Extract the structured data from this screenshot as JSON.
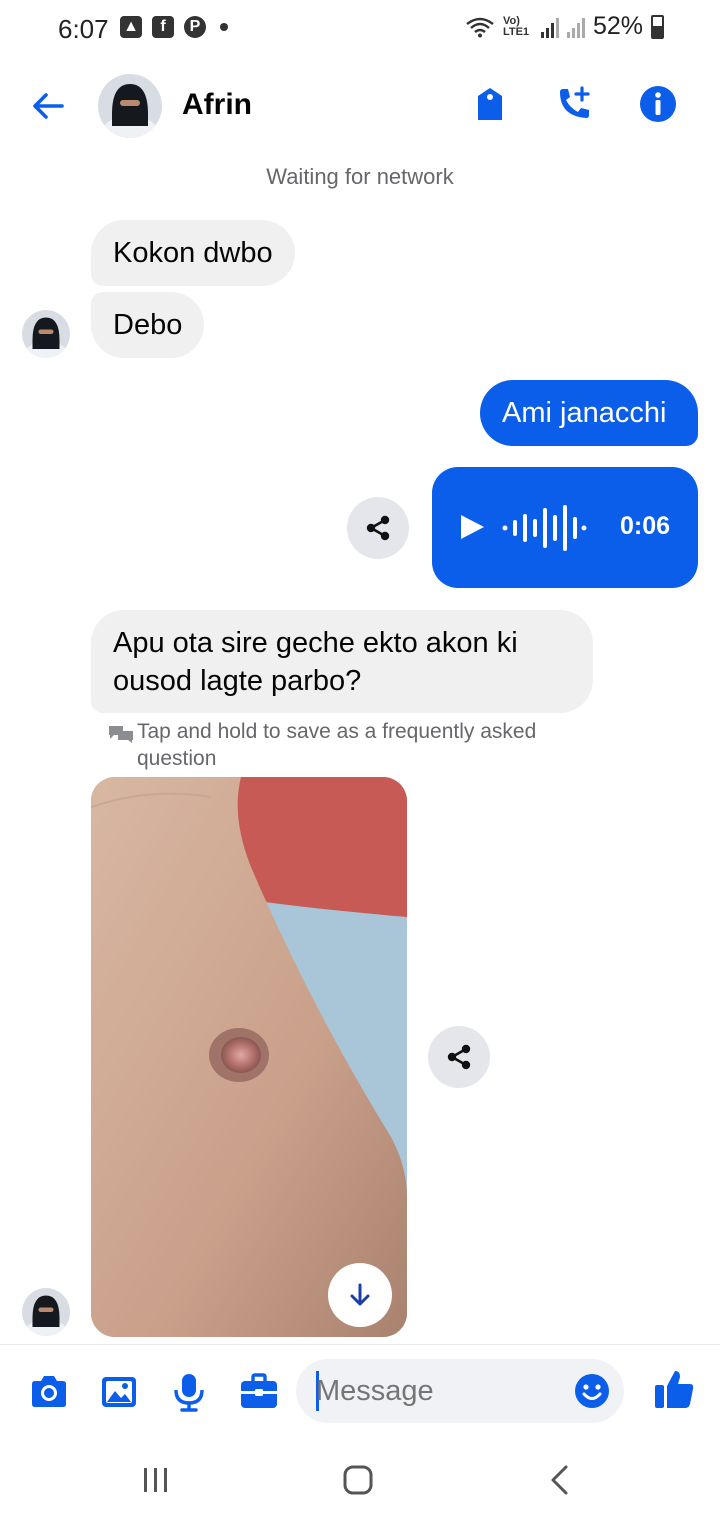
{
  "status_bar": {
    "time": "6:07",
    "battery": "52%",
    "network": "Vo) LTE1"
  },
  "header": {
    "contact_name": "Afrin",
    "icons": [
      "back-arrow-icon",
      "tag-icon",
      "add-call-icon",
      "info-icon"
    ]
  },
  "banner": {
    "network_status": "Waiting for network"
  },
  "messages": {
    "in_1": "Kokon dwbo",
    "in_2": "Debo",
    "out_1": "Ami janacchi",
    "voice_duration": "0:06",
    "in_3": "Apu ota sire geche ekto akon ki ousod lagte parbo?",
    "faq_hint": "Tap and hold to save as a frequently asked question"
  },
  "composer": {
    "placeholder": "Message",
    "icons": [
      "camera-icon",
      "gallery-icon",
      "microphone-icon",
      "briefcase-icon",
      "emoji-icon",
      "thumbs-up-icon"
    ]
  },
  "colors": {
    "accent": "#0a5eea",
    "incoming_bubble": "#f0f0f0",
    "secondary_text": "#65676b"
  }
}
